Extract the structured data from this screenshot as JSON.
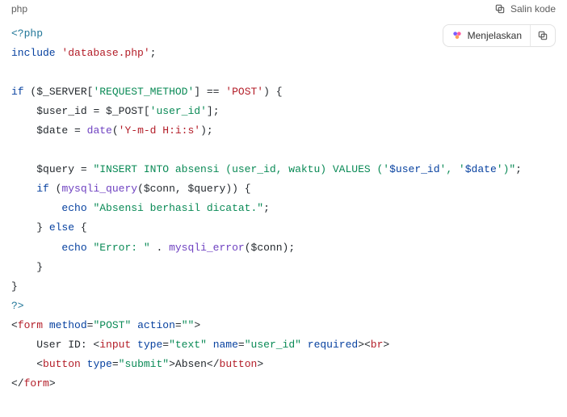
{
  "header": {
    "language": "php",
    "copy_label": "Salin kode"
  },
  "floating": {
    "explain_label": "Menjelaskan"
  },
  "code": {
    "l1_open": "<?php",
    "l2_kw": "include",
    "l2_str": "'database.php'",
    "l4_kw": "if",
    "l4_var": "$_SERVER",
    "l4_idx": "'REQUEST_METHOD'",
    "l4_str": "'POST'",
    "l5_var": "$user_id",
    "l5_post": "$_POST",
    "l5_idx": "'user_id'",
    "l6_var": "$date",
    "l6_func": "date",
    "l6_str": "'Y-m-d H:i:s'",
    "l8_var": "$query",
    "l8_str_a": "\"INSERT INTO absensi (user_id, waktu) VALUES ('",
    "l8_i1": "$user_id",
    "l8_str_b": "', '",
    "l8_i2": "$date",
    "l8_str_c": "')\"",
    "l9_kw": "if",
    "l9_func": "mysqli_query",
    "l9_a1": "$conn",
    "l9_a2": "$query",
    "l10_kw": "echo",
    "l10_str": "\"Absensi berhasil dicatat.\"",
    "l11_kw": "else",
    "l12_kw": "echo",
    "l12_str": "\"Error: \"",
    "l12_func": "mysqli_error",
    "l12_a1": "$conn",
    "l15_close": "?>",
    "l16_tag": "form",
    "l16_method": "method",
    "l16_method_v": "\"POST\"",
    "l16_action": "action",
    "l16_action_v": "\"\"",
    "l17_text": "    User ID: <",
    "l17_input": "input",
    "l17_type": "type",
    "l17_type_v": "\"text\"",
    "l17_name": "name",
    "l17_name_v": "\"user_id\"",
    "l17_req": "required",
    "l17_br": "br",
    "l18_button": "button",
    "l18_type": "type",
    "l18_type_v": "\"submit\"",
    "l18_text": "Absen",
    "l19_tag": "form"
  }
}
